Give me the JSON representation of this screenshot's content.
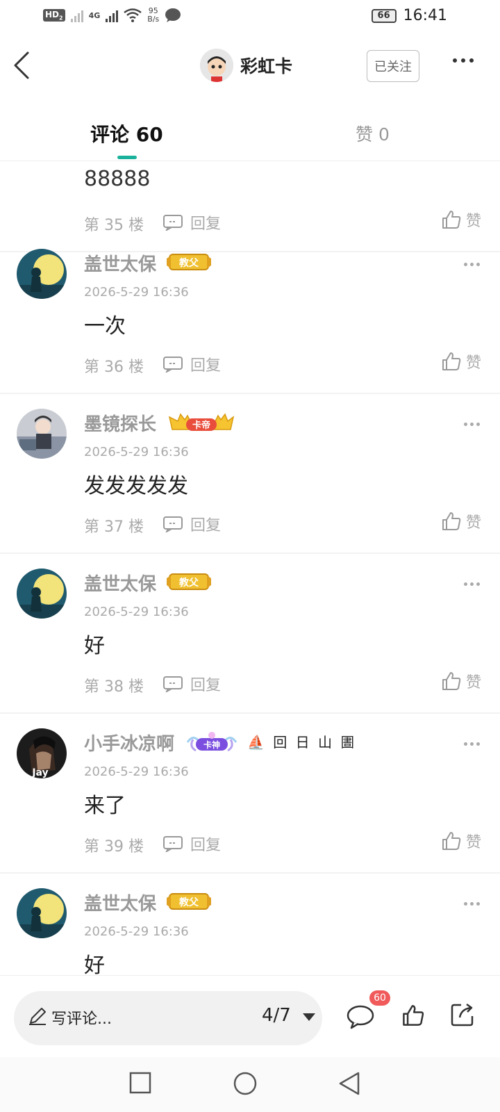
{
  "status_bar": {
    "hd": "HD",
    "hd_sub": "2",
    "net_type": "4G",
    "net_speed": "95",
    "net_unit": "B/s",
    "battery": "66",
    "time": "16:41"
  },
  "header": {
    "title": "彩虹卡",
    "follow_label": "已关注"
  },
  "tabs": {
    "comments_label": "评论 60",
    "likes_label": "赞 0"
  },
  "partial_comment": {
    "text": "88888",
    "floor": "第 35 楼",
    "reply_label": "回复",
    "like_label": "赞"
  },
  "comments": [
    {
      "name": "盖世太保",
      "badge": "教父",
      "time": "2026-5-29 16:36",
      "text": "一次",
      "floor": "第 36 楼",
      "reply_label": "回复",
      "like_label": "赞"
    },
    {
      "name": "墨镜探长",
      "badge": "卡帝",
      "time": "2026-5-29 16:36",
      "text": "发发发发发",
      "floor": "第 37 楼",
      "reply_label": "回复",
      "like_label": "赞"
    },
    {
      "name": "盖世太保",
      "badge": "教父",
      "time": "2026-5-29 16:36",
      "text": "好",
      "floor": "第 38 楼",
      "reply_label": "回复",
      "like_label": "赞"
    },
    {
      "name": "小手冰凉啊",
      "badge": "卡神",
      "extra_badge": "⛵ 回 日 山 圕",
      "avatar_label": "Jay",
      "time": "2026-5-29 16:36",
      "text": "来了",
      "floor": "第 39 楼",
      "reply_label": "回复",
      "like_label": "赞"
    },
    {
      "name": "盖世太保",
      "badge": "教父",
      "time": "2026-5-29 16:36",
      "text": "好",
      "floor": "",
      "reply_label": "",
      "like_label": ""
    }
  ],
  "bottom_bar": {
    "placeholder": "写评论...",
    "page": "4/7",
    "comment_count": "60"
  },
  "icons": {
    "back": "back-arrow-icon",
    "more": "more-dots-icon",
    "reply": "reply-bubble-icon",
    "like": "thumbs-up-icon",
    "comment": "comment-bubble-icon",
    "share": "share-icon",
    "pencil": "pencil-icon"
  },
  "colors": {
    "accent": "#1ab29b",
    "badge_gold": "#e8b93b",
    "count_red": "#f05a5a"
  }
}
